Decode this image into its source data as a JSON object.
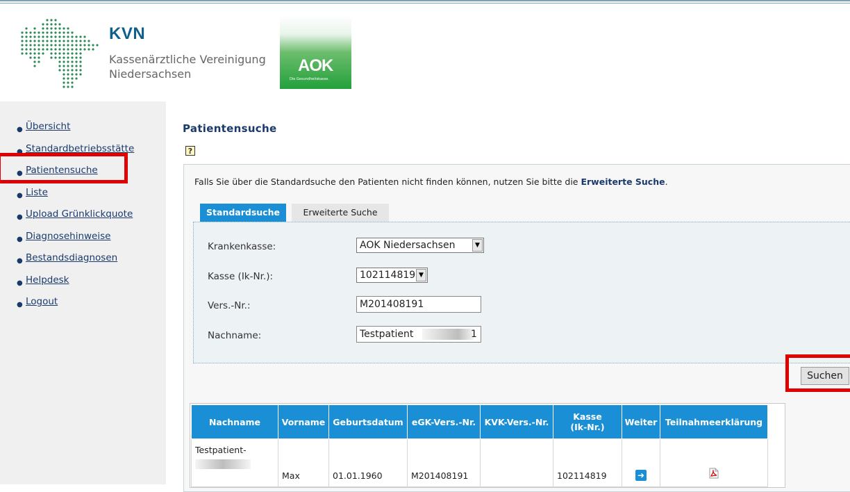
{
  "header": {
    "kvn_title": "KVN",
    "kvn_sub1": "Kassenärztliche Vereinigung",
    "kvn_sub2": "Niedersachsen",
    "aok_word": "AOK",
    "aok_tag": "Die Gesundheitskasse."
  },
  "sidebar": {
    "items": [
      {
        "label": "Übersicht"
      },
      {
        "label": "Standardbetriebsstätte"
      },
      {
        "label": "Patientensuche"
      },
      {
        "label": "Liste"
      },
      {
        "label": "Upload Grünklickquote"
      },
      {
        "label": "Diagnosehinweise"
      },
      {
        "label": "Bestandsdiagnosen"
      },
      {
        "label": "Helpdesk"
      },
      {
        "label": "Logout"
      }
    ]
  },
  "main": {
    "title": "Patientensuche",
    "help_glyph": "?",
    "info_prefix": "Falls Sie über die Standardsuche den Patienten nicht finden können, nutzen Sie bitte die ",
    "info_link": "Erweiterte Suche",
    "info_suffix": ".",
    "tabs": [
      {
        "label": "Standardsuche",
        "active": true
      },
      {
        "label": "Erweiterte Suche",
        "active": false
      }
    ],
    "form": {
      "krankenkasse_label": "Krankenkasse:",
      "krankenkasse_value": "AOK Niedersachsen",
      "kasse_label": "Kasse (Ik-Nr.):",
      "kasse_value": "102114819",
      "versnr_label": "Vers.-Nr.:",
      "versnr_value": "M201408191",
      "nachname_label": "Nachname:",
      "nachname_value": "Testpatient",
      "nachname_tail": "1"
    },
    "search_button": "Suchen",
    "results": {
      "headers": [
        "Nachname",
        "Vorname",
        "Geburtsdatum",
        "eGK-Vers.-Nr.",
        "KVK-Vers.-Nr.",
        "Kasse\n(Ik-Nr.)",
        "Weiter",
        "Teilnahmeerklärung"
      ],
      "header_kasse_1": "Kasse",
      "header_kasse_2": "(Ik-Nr.)",
      "rows": [
        {
          "nachname": "Testpatient-",
          "vorname": "Max",
          "geburtsdatum": "01.01.1960",
          "egk": "M201408191",
          "kvk": "",
          "kasse": "102114819"
        }
      ]
    }
  },
  "colors": {
    "accent": "#1a8fd6",
    "highlight": "#e00000",
    "brand": "#0e5f8c"
  }
}
